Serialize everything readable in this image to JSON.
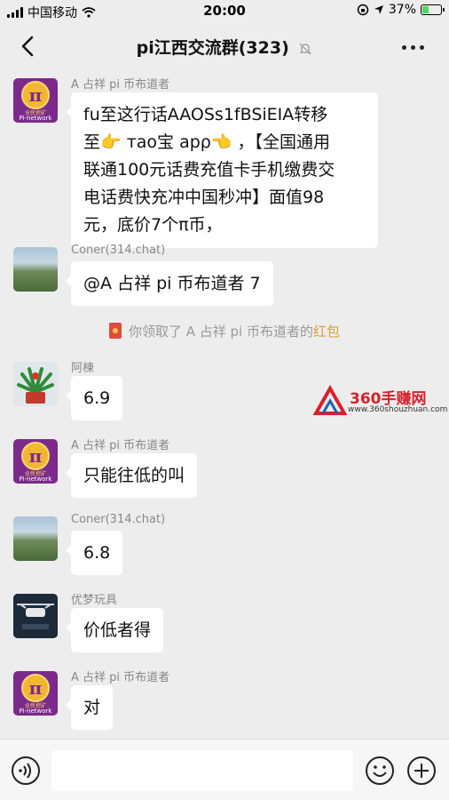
{
  "status_bar": {
    "carrier": "中国移动",
    "time": "20:00",
    "battery": "37%",
    "battery_level": 0.37
  },
  "header": {
    "title": "pi江西交流群(323)"
  },
  "messages": [
    {
      "sender": "A 占祥 pi 币布道者",
      "avatar_caption_top": "全民挖矿",
      "avatar_caption_bottom": "Pi-network",
      "line1": "fu至这行话AAOSs1fBSiEIA转移",
      "line2": "至👉 тao宝 apρ👈 ，【全国通用",
      "line3": "联通100元话费充值卡手机缴费交",
      "line4": "电话费快充冲中国秒冲】面值98",
      "line5": "元，底价7个π币，"
    },
    {
      "sender": "Coner(314.chat)",
      "text": "@A 占祥 pi 币布道者 7"
    },
    {
      "sender": "阿棟",
      "text": "6.9"
    },
    {
      "sender": "A 占祥 pi 币布道者",
      "text": "只能往低的叫"
    },
    {
      "sender": "Coner(314.chat)",
      "text": "6.8"
    },
    {
      "sender": "优梦玩具",
      "text": "价低者得"
    },
    {
      "sender": "A 占祥 pi 币布道者",
      "text": "对"
    }
  ],
  "system_notice": {
    "prefix": "你领取了 A 占祥 pi 币布道者的",
    "link": "红包"
  },
  "watermark": {
    "title": "360手赚网",
    "url": "www.360shouzhuan.com"
  },
  "input": {
    "placeholder": ""
  },
  "icons": {
    "back": "chevron-left-icon",
    "mute": "bell-slash-icon",
    "more": "more-icon",
    "voice": "voice-icon",
    "emoji": "emoji-icon",
    "plus": "plus-icon"
  }
}
